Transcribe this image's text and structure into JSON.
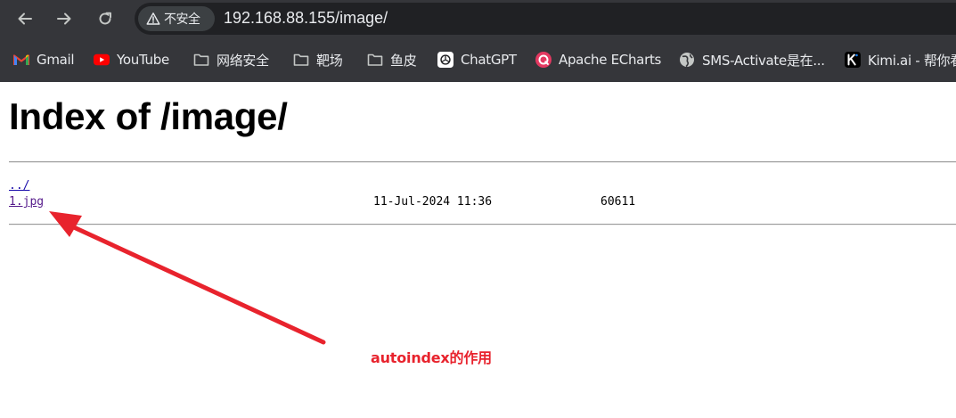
{
  "browser": {
    "security_label": "不安全",
    "url": "192.168.88.155/image/"
  },
  "bookmarks": [
    {
      "label": "Gmail",
      "icon": "gmail-icon"
    },
    {
      "label": "YouTube",
      "icon": "youtube-icon"
    },
    {
      "label": "网络安全",
      "icon": "folder-icon"
    },
    {
      "label": "靶场",
      "icon": "folder-icon"
    },
    {
      "label": "鱼皮",
      "icon": "folder-icon"
    },
    {
      "label": "ChatGPT",
      "icon": "chatgpt-icon"
    },
    {
      "label": "Apache ECharts",
      "icon": "echarts-icon"
    },
    {
      "label": "SMS-Activate是在...",
      "icon": "globe-icon"
    },
    {
      "label": "Kimi.ai - 帮你看",
      "icon": "kimi-icon"
    }
  ],
  "page": {
    "title": "Index of /image/",
    "entries": [
      {
        "name": "../",
        "date": "",
        "size": ""
      },
      {
        "name": "1.jpg",
        "date": "11-Jul-2024 11:36",
        "size": "60611"
      }
    ]
  },
  "annotation": {
    "text": "autoindex的作用",
    "color": "#e8232d"
  },
  "colors": {
    "chrome_bg": "#35363a",
    "omnibox_bg": "#202124",
    "link": "#1a0dab",
    "visited_link": "#551a8b"
  }
}
